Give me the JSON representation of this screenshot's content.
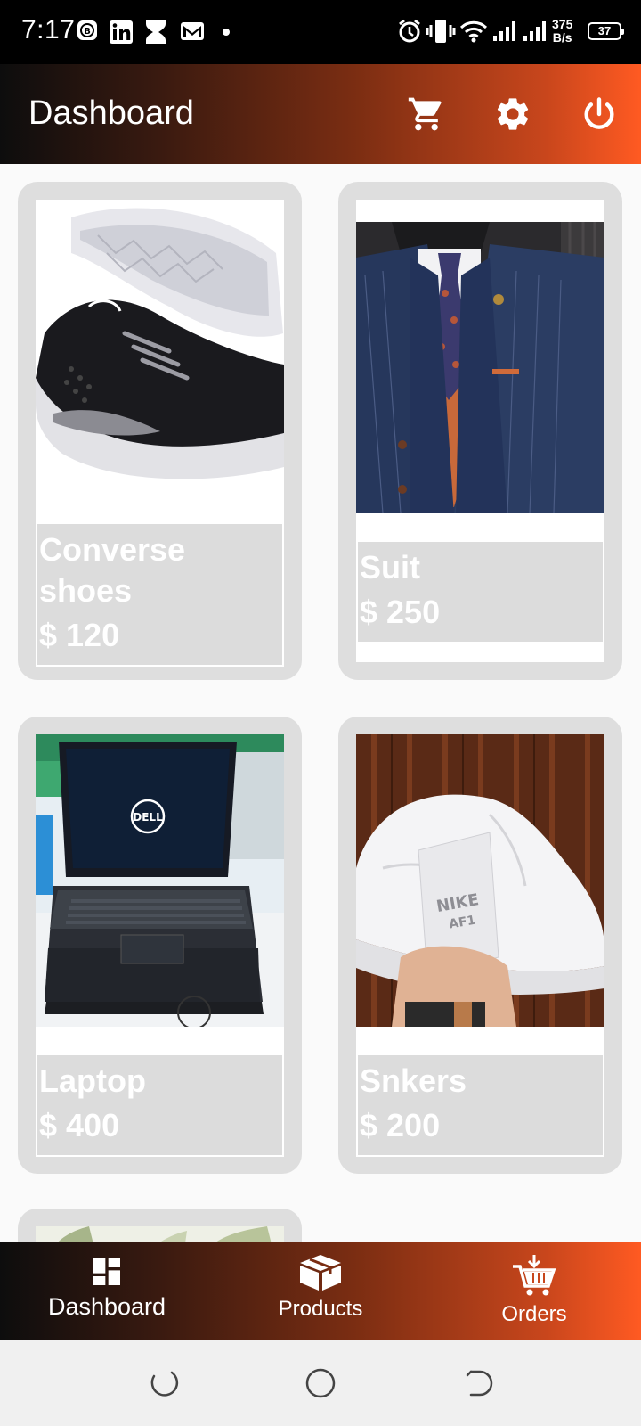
{
  "status_bar": {
    "time": "7:17",
    "net_speed_value": "375",
    "net_speed_unit": "B/s",
    "battery": "37"
  },
  "app_bar": {
    "title": "Dashboard",
    "actions": [
      "cart-icon",
      "gear-icon",
      "power-icon"
    ]
  },
  "products": [
    {
      "name": "Converse shoes",
      "price": "$ 120",
      "image": "black sneaker"
    },
    {
      "name": "Suit",
      "price": "$ 250",
      "image": "navy pinstripe suit"
    },
    {
      "name": "Laptop",
      "price": "$ 400",
      "image": "dell laptop stack"
    },
    {
      "name": "Snkers",
      "price": "$ 200",
      "image": "white sneaker in hand"
    }
  ],
  "bottom_nav": {
    "items": [
      {
        "label": "Dashboard",
        "icon": "dashboard-icon",
        "active": true
      },
      {
        "label": "Products",
        "icon": "box-icon",
        "active": false
      },
      {
        "label": "Orders",
        "icon": "cart-download-icon",
        "active": false
      }
    ]
  },
  "colors": {
    "gradient_start": "#0d0d0d",
    "gradient_end": "#ff5a22",
    "card_bg": "#dedede",
    "caption_bg": "#dcdcdc"
  }
}
